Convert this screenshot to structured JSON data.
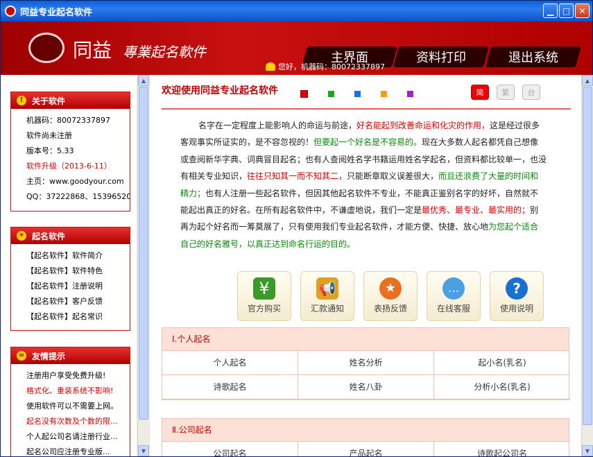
{
  "window": {
    "title": "同益专业起名软件",
    "minimize_glyph": "▁",
    "maximize_glyph": "□",
    "close_glyph": "✕"
  },
  "banner": {
    "brand": "同益",
    "brand_sub": "專業起名軟件",
    "greeting": "您好，机器码：80072337897",
    "nav": [
      {
        "label": "主界面"
      },
      {
        "label": "资料打印"
      },
      {
        "label": "退出系统"
      }
    ]
  },
  "sidebar": {
    "about": {
      "title": "关于软件",
      "lines": [
        "机器码：80072337897",
        "软件尚未注册",
        "版本号：5.33",
        "软件升级（2013-6-11）",
        "主页：www.goodyour.com",
        "QQ：37222868、15396520..."
      ]
    },
    "software": {
      "title": "起名软件",
      "items": [
        "【起名软件】软件简介",
        "【起名软件】软件特色",
        "【起名软件】注册说明",
        "【起名软件】客户反馈",
        "【起名软件】起名常识"
      ]
    },
    "tips": {
      "title": "友情提示",
      "items": [
        "注册用户享受免费升级!",
        "格式化、重装系统不影响!",
        "使用软件可以不需要上网。",
        "起名没有次数及个数的限...",
        "个人起公司名请注册行业...",
        "起名公司应注册专业版..."
      ]
    }
  },
  "main": {
    "welcome": "欢迎使用同益专业起名软件",
    "lang": [
      "简",
      "繁",
      "台"
    ],
    "swatch_colors": [
      "#e00000",
      "#1aa81a",
      "#1a6ee0",
      "#ff9a10",
      "#a020d0"
    ],
    "intro": {
      "p1": "名字在一定程度上能影响人的命运与前途，",
      "p2": "好名能起到改善命运和化灾的作用，",
      "p3": "这是经过很多客观事实所证实的，是不容忽视的！",
      "p4": "但要起一个好名是不容易的。",
      "p5": "现在大多数人起名都凭自己想像或查阅新华字典、词典冒目起名；也有人查阅姓名学书籍运用姓名学起名，但资料都比较单一，也没有相关专业知识，",
      "p6": "往往只知其一而不知其二，",
      "p7": "只能断章取义误差很大，",
      "p8": "而且还浪费了大量的时间和精力；",
      "p9": "也有人注册一些起名软件，但因其他起名软件不专业，不能真正鉴别名字的好坏，自然就不能起出真正的好名。在所有起名软件中，不谦虚地说，我们一定是",
      "p10": "最优秀、最专业、最实用的；",
      "p11": "别再为起个好名而一筹莫展了，只有使用我们专业起名软件，才能方便、快捷、放心地",
      "p12": "为您起个适合自己的好名雅号，以真正达到命名行运的目的。"
    },
    "actions": [
      {
        "label": "官方购买",
        "icon": "yen-icon",
        "color": "#3a9a2a"
      },
      {
        "label": "汇款通知",
        "icon": "horn-icon",
        "color": "#e0a020"
      },
      {
        "label": "表扬反馈",
        "icon": "medal-icon",
        "color": "#e87020"
      },
      {
        "label": "在线客服",
        "icon": "chat-icon",
        "color": "#4aa0e0"
      },
      {
        "label": "使用说明",
        "icon": "help-icon",
        "color": "#1a70d0"
      }
    ],
    "sections": [
      {
        "title": "Ⅰ.个人起名",
        "cells": [
          "个人起名",
          "姓名分析",
          "起小名(乳名)",
          "诗歌起名",
          "姓名八卦",
          "分析小名(乳名)"
        ]
      },
      {
        "title": "Ⅱ.公司起名",
        "cells": [
          "公司起名",
          "产品起名",
          "诗歌起公司名"
        ]
      }
    ]
  }
}
